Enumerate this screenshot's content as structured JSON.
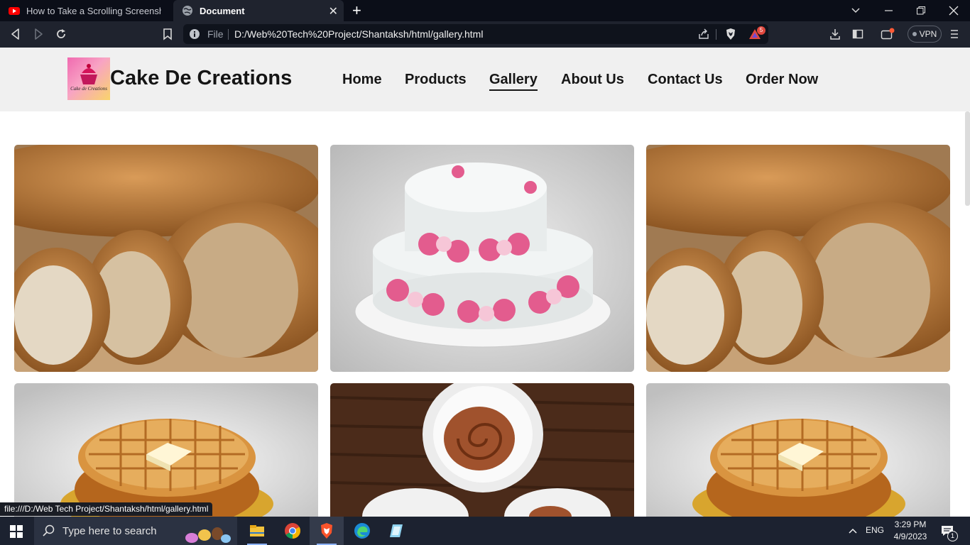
{
  "browser": {
    "tabs": [
      {
        "label": "How to Take a Scrolling Screenshot in",
        "active": false
      },
      {
        "label": "Document",
        "active": true
      }
    ],
    "address": {
      "scheme_label": "File",
      "url": "D:/Web%20Tech%20Project/Shantaksh/html/gallery.html"
    },
    "shields_badge": "5",
    "vpn_label": "VPN",
    "status_tooltip": "file:///D:/Web Tech Project/Shantaksh/html/gallery.html"
  },
  "site": {
    "brand": "Cake De Creations",
    "logo_text": "Cake de Creations",
    "nav": [
      {
        "label": "Home",
        "current": false
      },
      {
        "label": "Products",
        "current": false
      },
      {
        "label": "Gallery",
        "current": true
      },
      {
        "label": "About Us",
        "current": false
      },
      {
        "label": "Contact Us",
        "current": false
      },
      {
        "label": "Order Now",
        "current": false
      }
    ],
    "gallery": [
      {
        "photo": "sesame-bread"
      },
      {
        "photo": "rose-cake"
      },
      {
        "photo": "sesame-bread"
      },
      {
        "photo": "waffles-with-butter"
      },
      {
        "photo": "cinnamon-rolls"
      },
      {
        "photo": "waffles-with-butter"
      }
    ]
  },
  "taskbar": {
    "search_placeholder": "Type here to search",
    "language": "ENG",
    "time": "3:29 PM",
    "date": "4/9/2023",
    "notification_count": "1",
    "pinned_apps": [
      "file-explorer-icon",
      "chrome-icon",
      "brave-icon",
      "edge-icon",
      "notepad-icon"
    ]
  },
  "colors": {
    "tabbar_bg": "#0b0e18",
    "toolbar_bg": "#1f232e",
    "header_bg": "#f0f0f0",
    "taskbar_bg": "#1c2230"
  }
}
